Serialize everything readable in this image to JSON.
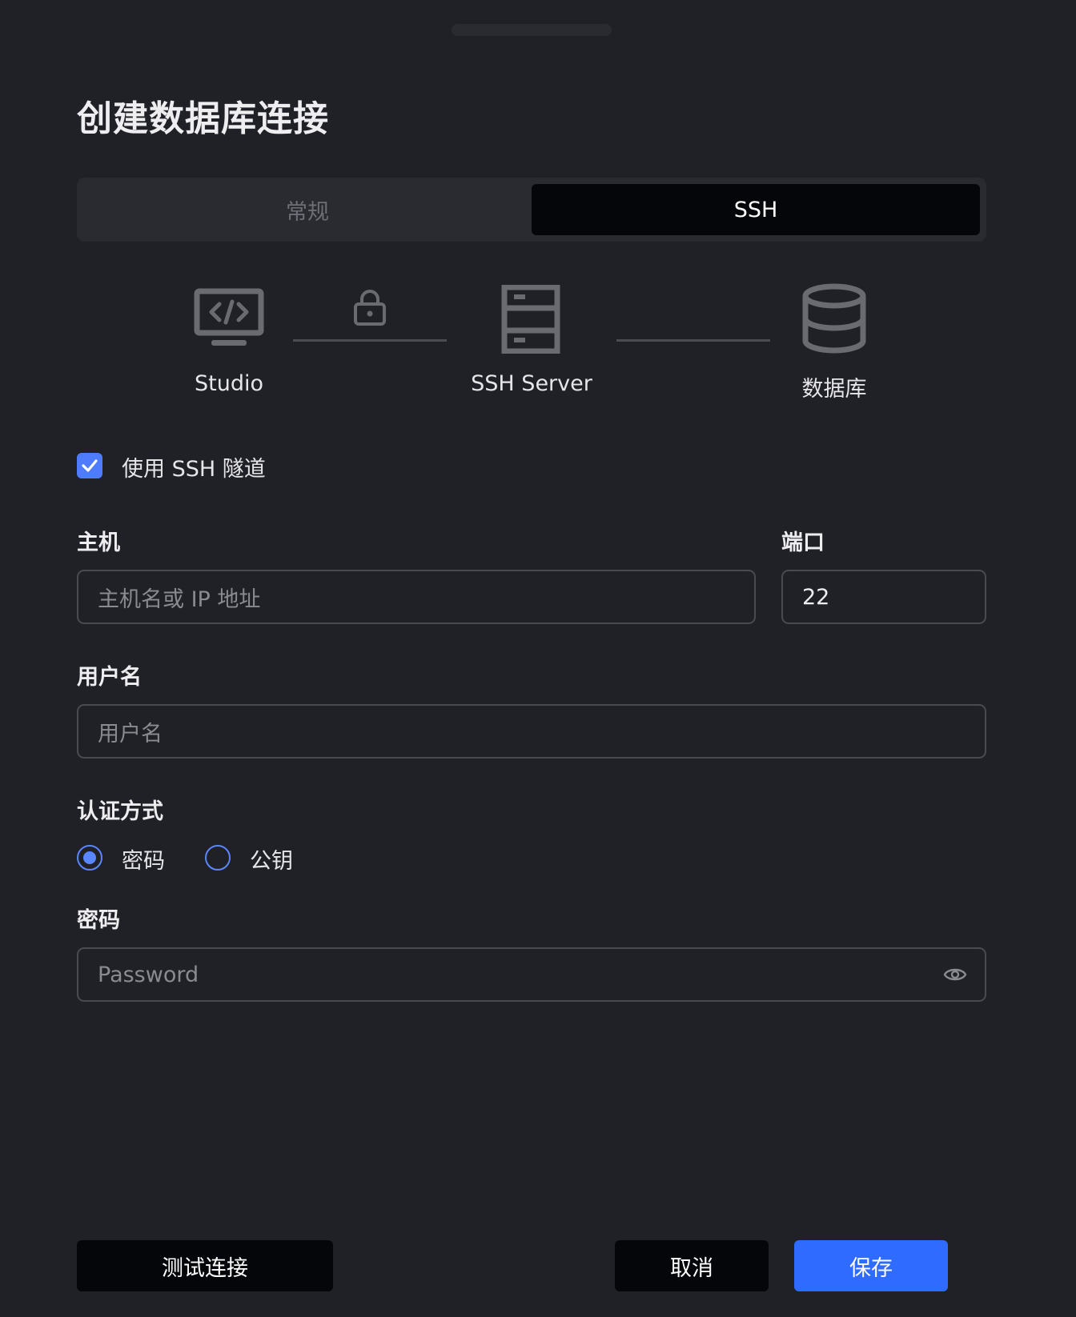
{
  "dialog": {
    "title": "创建数据库连接"
  },
  "tabs": [
    {
      "label": "常规",
      "active": false
    },
    {
      "label": "SSH",
      "active": true
    }
  ],
  "diagram": {
    "nodes": [
      {
        "label": "Studio",
        "icon": "code-monitor-icon"
      },
      {
        "label": "SSH Server",
        "icon": "server-icon"
      },
      {
        "label": "数据库",
        "icon": "database-icon"
      }
    ],
    "link_icon": "lock-icon"
  },
  "ssh_tunnel": {
    "label": "使用 SSH 隧道",
    "checked": true
  },
  "host": {
    "label": "主机",
    "placeholder": "主机名或 IP 地址",
    "value": ""
  },
  "port": {
    "label": "端口",
    "value": "22"
  },
  "username": {
    "label": "用户名",
    "placeholder": "用户名",
    "value": ""
  },
  "auth": {
    "label": "认证方式",
    "options": [
      {
        "label": "密码",
        "selected": true
      },
      {
        "label": "公钥",
        "selected": false
      }
    ]
  },
  "password": {
    "label": "密码",
    "placeholder": "Password",
    "value": "",
    "toggle_icon": "eye-icon"
  },
  "buttons": {
    "test": "测试连接",
    "cancel": "取消",
    "save": "保存"
  },
  "colors": {
    "accent": "#2f6bff",
    "background": "#202127"
  }
}
